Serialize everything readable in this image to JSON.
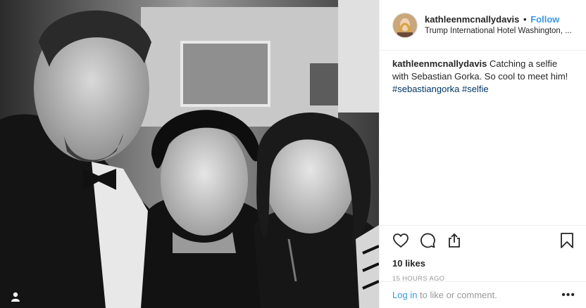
{
  "post": {
    "username": "kathleenmcnallydavis",
    "separator": "•",
    "follow_label": "Follow",
    "location": "Trump International Hotel Washington, ...",
    "caption_text": "Catching a selfie with Sebastian Gorka. So cool to meet him!",
    "hashtags": [
      "#sebastiangorka",
      "#selfie"
    ],
    "likes": "10 likes",
    "timestamp": "15 HOURS AGO",
    "login_link": "Log in",
    "login_rest": " to like or comment.",
    "more_label": "•••"
  },
  "icons": {
    "like": "heart-icon",
    "comment": "comment-icon",
    "share": "share-icon",
    "save": "bookmark-icon",
    "tagged": "user-tag-icon",
    "options": "more-options-icon"
  },
  "colors": {
    "link": "#3897f0",
    "hashtag": "#003569",
    "muted": "#999999"
  }
}
